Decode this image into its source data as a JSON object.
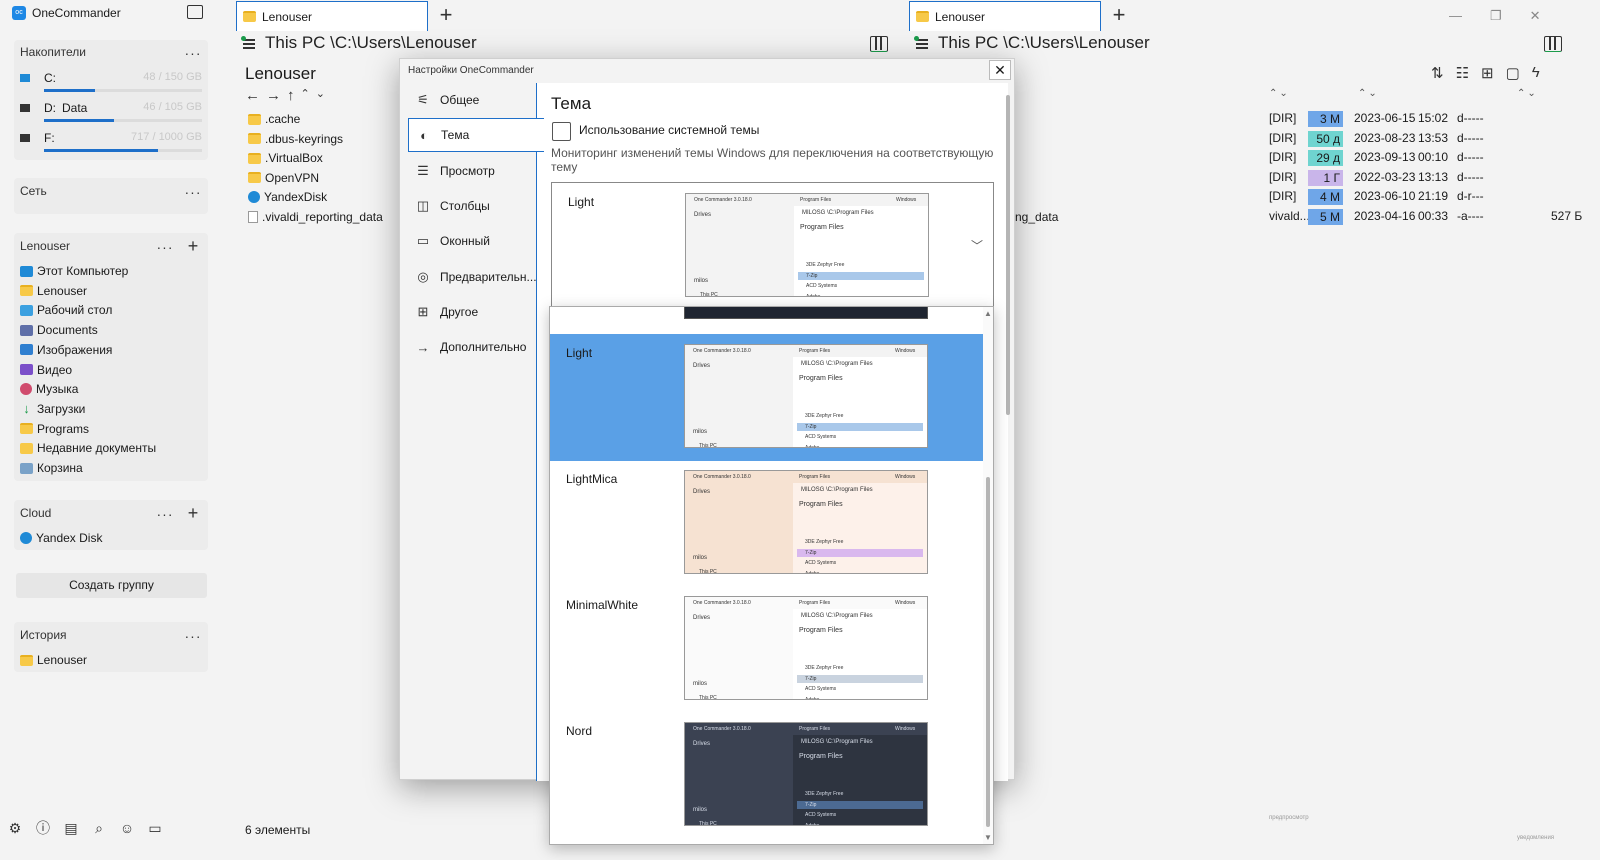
{
  "app": {
    "name": "OneCommander"
  },
  "sidebar": {
    "drives_header": "Накопители",
    "drives": [
      {
        "letter": "C:",
        "label": "",
        "size": "48 / 150 GB",
        "used": 0.32
      },
      {
        "letter": "D:",
        "label": "Data",
        "size": "46 / 105 GB",
        "used": 0.44
      },
      {
        "letter": "F:",
        "label": "",
        "size": "717 / 1000 GB",
        "used": 0.72
      }
    ],
    "network_header": "Сеть",
    "group_header": "Lenouser",
    "favorites": [
      {
        "label": "Этот Компьютер",
        "icon": "pc"
      },
      {
        "label": "Lenouser",
        "icon": "folder"
      },
      {
        "label": "Рабочий стол",
        "icon": "desktop"
      },
      {
        "label": "Documents",
        "icon": "docs"
      },
      {
        "label": "Изображения",
        "icon": "pics"
      },
      {
        "label": "Видео",
        "icon": "video"
      },
      {
        "label": "Музыка",
        "icon": "music"
      },
      {
        "label": "Загрузки",
        "icon": "down"
      },
      {
        "label": "Programs",
        "icon": "folder"
      },
      {
        "label": "Недавние документы",
        "icon": "recent"
      },
      {
        "label": "Корзина",
        "icon": "bin"
      }
    ],
    "cloud_header": "Cloud",
    "cloud_items": [
      {
        "label": "Yandex Disk",
        "icon": "cloud"
      }
    ],
    "create_group": "Создать группу",
    "history_header": "История",
    "history_items": [
      {
        "label": "Lenouser",
        "icon": "folder"
      }
    ],
    "dots": "···",
    "plus": "+"
  },
  "left_pane": {
    "tab": "Lenouser",
    "address": "This PC \\C:\\Users\\Lenouser",
    "title": "Lenouser",
    "files": [
      {
        "name": ".cache",
        "icon": "folder"
      },
      {
        "name": ".dbus-keyrings",
        "icon": "folder"
      },
      {
        "name": ".VirtualBox",
        "icon": "folder"
      },
      {
        "name": "OpenVPN",
        "icon": "folder"
      },
      {
        "name": "YandexDisk",
        "icon": "cloud"
      },
      {
        "name": ".vivaldi_reporting_data",
        "icon": "file"
      }
    ],
    "status": "6 элементы"
  },
  "right_pane": {
    "tab": "Lenouser",
    "address": "This PC \\C:\\Users\\Lenouser",
    "partial_names": [
      "s",
      "ting_data"
    ],
    "rows": [
      {
        "ext": "[DIR]",
        "size": "3 M",
        "size_color": "#6fa6e8",
        "date": "2023-06-15",
        "time": "15:02",
        "attr": "d-----",
        "bytes": ""
      },
      {
        "ext": "[DIR]",
        "size": "50 д",
        "size_color": "#6fd4d0",
        "date": "2023-08-23",
        "time": "13:53",
        "attr": "d-----",
        "bytes": ""
      },
      {
        "ext": "[DIR]",
        "size": "29 д",
        "size_color": "#6fd4d0",
        "date": "2023-09-13",
        "time": "00:10",
        "attr": "d-----",
        "bytes": ""
      },
      {
        "ext": "[DIR]",
        "size": "1 Г",
        "size_color": "#c9b5ea",
        "date": "2022-03-23",
        "time": "13:13",
        "attr": "d-----",
        "bytes": ""
      },
      {
        "ext": "[DIR]",
        "size": "4 M",
        "size_color": "#6fa6e8",
        "date": "2023-06-10",
        "time": "21:19",
        "attr": "d-r---",
        "bytes": ""
      },
      {
        "ext": "vivald...",
        "size": "5 M",
        "size_color": "#6fa6e8",
        "date": "2023-04-16",
        "time": "00:33",
        "attr": "-a----",
        "bytes": "527 Б"
      }
    ],
    "hint_preview": "предпросмотр",
    "hint_notify": "уведомления"
  },
  "dialog": {
    "title": "Настройки OneCommander",
    "close": "✕",
    "nav": [
      {
        "label": "Общее",
        "icon": "sliders-icon",
        "glyph": "⚟"
      },
      {
        "label": "Тема",
        "icon": "palette-icon",
        "glyph": "◐"
      },
      {
        "label": "Просмотр",
        "icon": "list-icon",
        "glyph": "☰"
      },
      {
        "label": "Столбцы",
        "icon": "columns-icon",
        "glyph": "◫"
      },
      {
        "label": "Оконный",
        "icon": "window-icon",
        "glyph": "▭"
      },
      {
        "label": "Предварительн...",
        "icon": "eye-icon",
        "glyph": "◎"
      },
      {
        "label": "Другое",
        "icon": "puzzle-icon",
        "glyph": "⊞"
      },
      {
        "label": "Дополнительно",
        "icon": "arrow-right-icon",
        "glyph": "→"
      }
    ],
    "heading": "Тема",
    "system_theme_label": "Использование системной темы",
    "system_theme_checked": false,
    "description": "Мониторинг изменений темы Windows для переключения на соответствующую тему",
    "selected_theme": "Light",
    "themes": [
      {
        "name": "Light",
        "bg": "#ffffff",
        "panel": "#f3f3f3",
        "accent": "#a9c8ea",
        "fg": "#333333"
      },
      {
        "name": "LightMica",
        "bg": "#fdf1ea",
        "panel": "#f6e2d2",
        "accent": "#d9b8ee",
        "fg": "#333333"
      },
      {
        "name": "MinimalWhite",
        "bg": "#ffffff",
        "panel": "#fafafa",
        "accent": "#c9d3df",
        "fg": "#333333"
      },
      {
        "name": "Nord",
        "bg": "#2e3440",
        "panel": "#3b4252",
        "accent": "#4c6a92",
        "fg": "#d8dee9"
      }
    ],
    "preview_text": {
      "app": "One Commander 3.0.18.0",
      "tab1": "Program Files",
      "tab2": "Windows",
      "drives": "Drives",
      "path": "MILOSG \\C:\\Program Files",
      "folder": "Program Files",
      "items": [
        "3DE Zephyr Free",
        "7-Zip",
        "ACD Systems",
        "Adobe"
      ],
      "user": "milos",
      "pc": "This PC"
    }
  }
}
